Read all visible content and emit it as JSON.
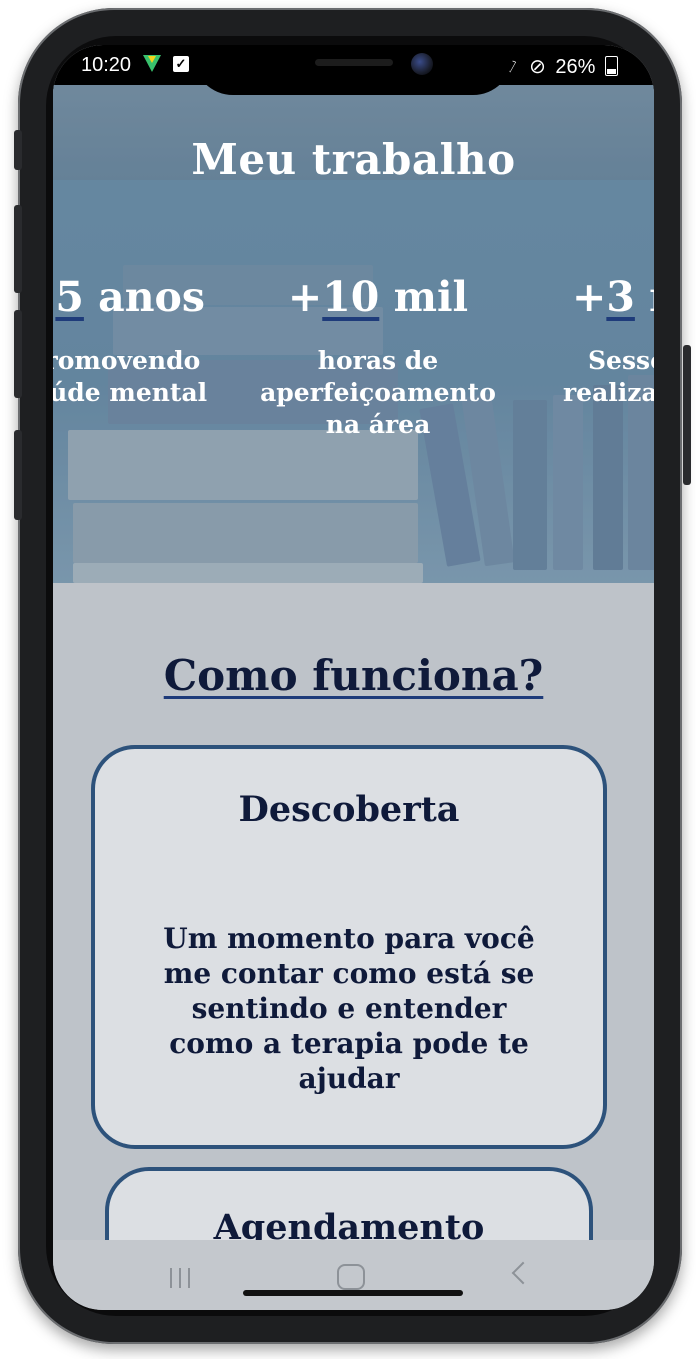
{
  "status_bar": {
    "time": "10:20",
    "right": "26%",
    "battery_icon": "battery-icon",
    "wifi_icon": "wifi-icon",
    "dnd_icon": "do-not-disturb-icon"
  },
  "hero": {
    "title": "Meu trabalho",
    "stats": [
      {
        "prefix": "+",
        "number": "5",
        "suffix": " anos",
        "label_lines": [
          "Promovendo",
          "saúde mental"
        ]
      },
      {
        "prefix": "+",
        "number": "10",
        "suffix": " mil",
        "label_lines": [
          "horas de",
          "aperfeiçoamento",
          "na área"
        ]
      },
      {
        "prefix": "+",
        "number": "3",
        "suffix": " mil",
        "label_lines": [
          "Sessões",
          "realizadas"
        ]
      }
    ]
  },
  "how": {
    "title": "Como funciona?",
    "cards": [
      {
        "title": "Descoberta",
        "text": "Um momento para você me contar como está se sentindo e entender como a terapia pode te ajudar"
      },
      {
        "title": "Agendamento",
        "text": ""
      }
    ]
  },
  "colors": {
    "accent": "#1e3b7a",
    "card_border": "#2d527b",
    "text_dark": "#0f1a3a",
    "background": "#bec3c9"
  }
}
